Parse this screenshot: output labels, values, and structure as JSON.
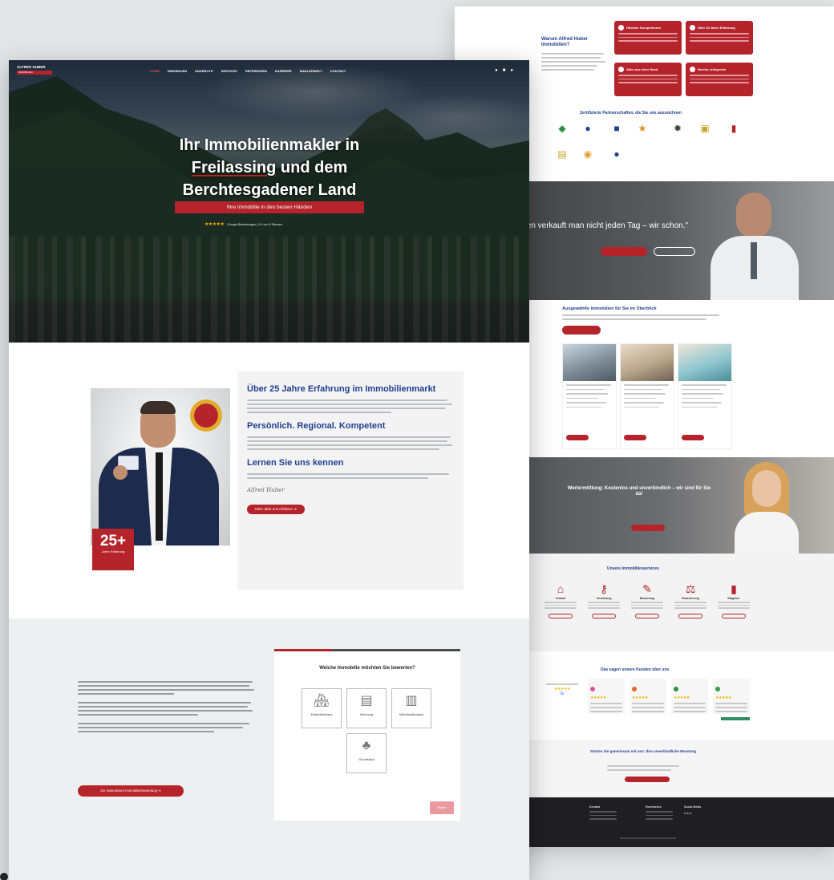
{
  "hero": {
    "logo_name": "ALFRED HUBER",
    "logo_tag": "IMMOBILIEN",
    "nav": [
      "HOME",
      "IMMOBILIEN",
      "ANGEBOTE",
      "SERVICES",
      "REFERENZEN",
      "KARRIERE",
      "MAKLERWELT",
      "KONTAKT"
    ],
    "title_line1": "Ihr Immobilienmakler in",
    "title_line2a": "Freilassing",
    "title_line2b": " und dem",
    "title_line3": "Berchtesgadener Land",
    "subtitle": "Ihre Immobilie in den besten Händen",
    "stars": "★★★★★",
    "rating_text": "Google Bewertungen | 4.9 von 5 Sternen"
  },
  "about": {
    "years_number": "25+",
    "years_label": "Jahre Erfahrung",
    "heading1": "Über 25 Jahre Erfahrung im Immobilienmarkt",
    "heading2": "Persönlich. Regional. Kompetent",
    "heading3": "Lernen Sie uns kennen",
    "signature": "Alfred Huber",
    "button": "Mehr über uns erfahren ➔"
  },
  "valuation": {
    "cta": "Zur kostenlosen Immobilienbewertung ➔",
    "question": "Welche Immobilie möchten Sie bewerten?",
    "options": [
      {
        "label": "Einfamilienhaus",
        "icon": "🏘"
      },
      {
        "label": "Wohnung",
        "icon": "▤"
      },
      {
        "label": "Mehrfamilienhaus",
        "icon": "▥"
      },
      {
        "label": "Grundstück",
        "icon": "♣"
      }
    ],
    "next": "Weiter"
  },
  "right": {
    "why_title": "Warum Alfred Huber Immobilien?",
    "boxes": [
      "Höchste Kompetenzen",
      "Über 25 Jahre Erfahrung",
      "Alles aus einer Hand",
      "Bereits erfolgreich"
    ],
    "cert_title": "Zertifizierte Partnerschaften, die Sie uns auszeichnen",
    "quote": "\"Immobilien verkauft man nicht jeden Tag – wir schon.\"",
    "props_title": "Ausgewählte Immobilien für Sie im Überblick",
    "cta_text": "Wertermittlung: Kostenlos und unverbindlich – wir sind für Sie da!",
    "services_title": "Unsere Immobilienservices",
    "services": [
      "Verkauf",
      "Vermietung",
      "Bewertung",
      "Finanzierung",
      "Ratgeber"
    ],
    "reviews_title": "Das sagen unsere Kunden über uns",
    "cta2_text": "Starten Sie gemeinsam mit uns: Ihre unverbindliche Beratung",
    "footer_cols": [
      "Kontakt",
      "Rechtliches",
      "Social Media"
    ]
  },
  "colors": {
    "brand_red": "#b5232b",
    "brand_blue": "#1f3f8f"
  }
}
